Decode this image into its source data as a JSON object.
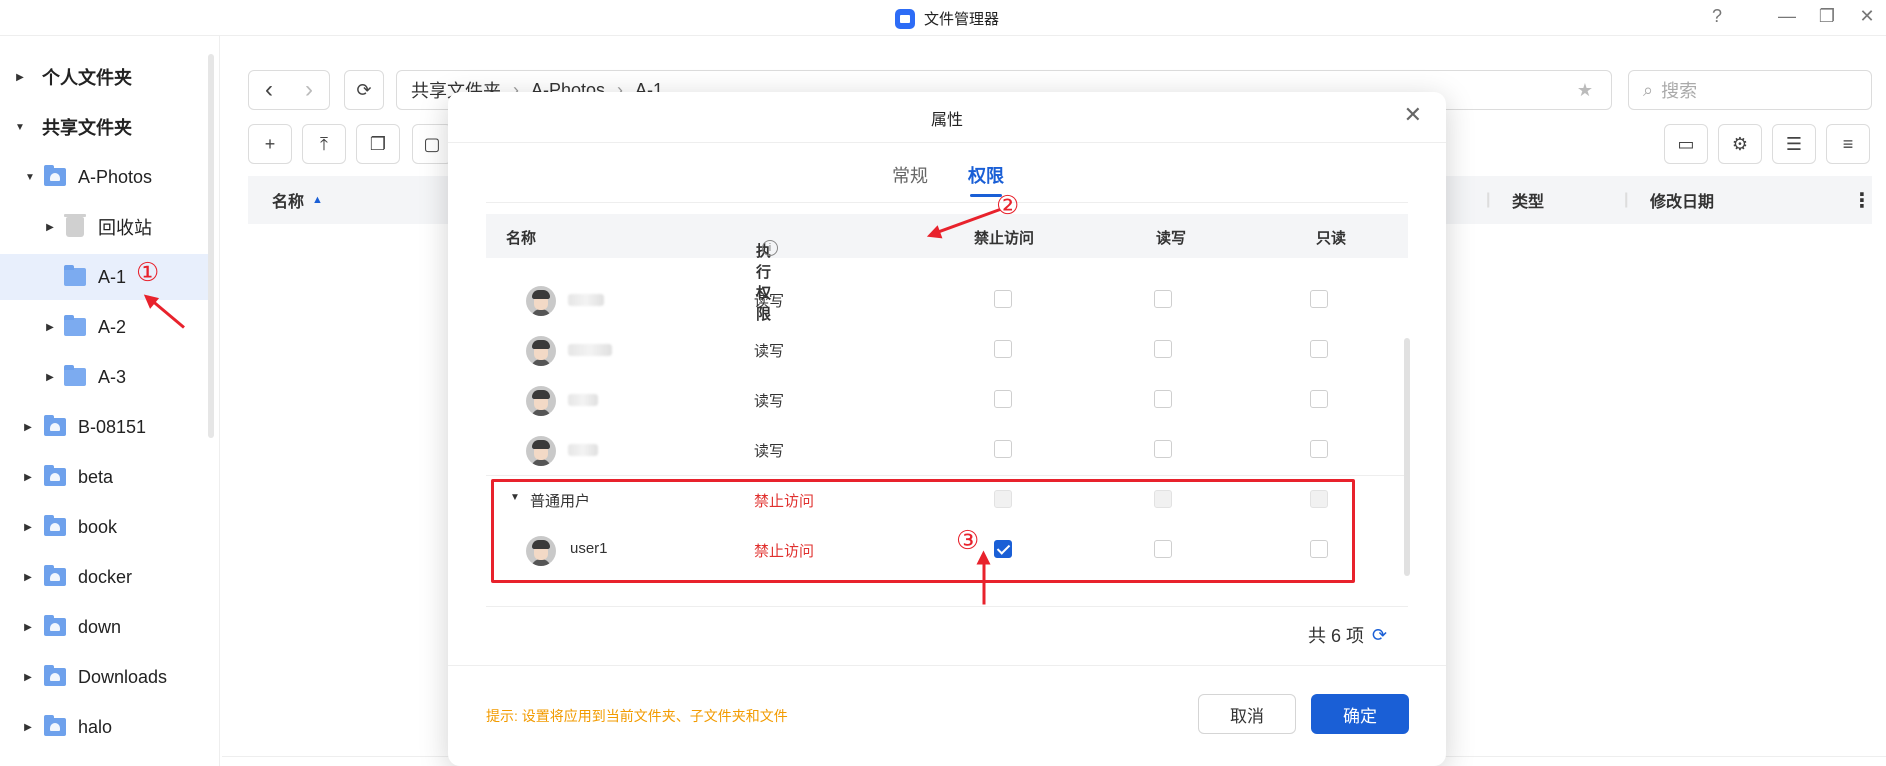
{
  "app": {
    "title": "文件管理器"
  },
  "window_controls": {
    "help": "?",
    "minimize": "—",
    "restore": "❐",
    "close": "✕"
  },
  "sidebar": {
    "personal": "个人文件夹",
    "shared": "共享文件夹",
    "items": [
      {
        "label": "A-Photos"
      },
      {
        "label": "回收站"
      },
      {
        "label": "A-1"
      },
      {
        "label": "A-2"
      },
      {
        "label": "A-3"
      },
      {
        "label": "B-08151"
      },
      {
        "label": "beta"
      },
      {
        "label": "book"
      },
      {
        "label": "docker"
      },
      {
        "label": "down"
      },
      {
        "label": "Downloads"
      },
      {
        "label": "halo"
      }
    ]
  },
  "toolbar": {
    "back": "‹",
    "forward": "›",
    "refresh": "⟳",
    "path": [
      "共享文件夹",
      "A-Photos",
      "A-1"
    ],
    "path_sep": "›",
    "search_placeholder": "搜索",
    "add": "+",
    "upload": "⤒"
  },
  "list_header": {
    "name": "名称",
    "type": "类型",
    "modified": "修改日期",
    "more": "⋮"
  },
  "dialog": {
    "title": "属性",
    "close": "✕",
    "tabs": [
      "常规",
      "权限"
    ],
    "active_tab": "权限",
    "columns": {
      "name": "名称",
      "exec": "执行权限",
      "info": "i",
      "deny": "禁止访问",
      "rw": "读写",
      "ro": "只读"
    },
    "rows": [
      {
        "perm": "读写"
      },
      {
        "perm": "读写"
      },
      {
        "perm": "读写"
      },
      {
        "perm": "读写"
      }
    ],
    "group": {
      "name": "普通用户",
      "perm": "禁止访问"
    },
    "user": {
      "name": "user1",
      "perm": "禁止访问",
      "deny_checked": true
    },
    "count": "共 6 项",
    "refresh": "⟳",
    "hint": "提示: 设置将应用到当前文件夹、子文件夹和文件",
    "cancel": "取消",
    "ok": "确定"
  },
  "annotations": {
    "m1": "①",
    "m2": "②",
    "m3": "③"
  },
  "colors": {
    "accent": "#1a5fd6",
    "annotation": "#e8222c",
    "warning": "#f29b00",
    "deny": "#e0302e"
  }
}
